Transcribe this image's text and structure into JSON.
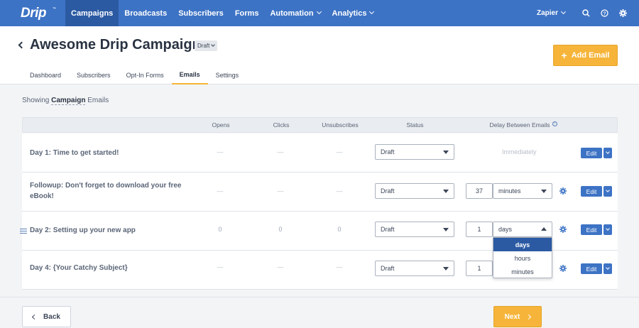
{
  "brand": {
    "logo": "Drip",
    "tm": "™",
    "primary": "#3d73c5",
    "accent": "#f6b53a"
  },
  "nav": {
    "items": [
      {
        "label": "Campaigns",
        "active": true
      },
      {
        "label": "Broadcasts"
      },
      {
        "label": "Subscribers"
      },
      {
        "label": "Forms"
      },
      {
        "label": "Automation"
      },
      {
        "label": "Analytics"
      }
    ],
    "user": "Zapier",
    "icons": [
      "search-icon",
      "help-icon",
      "gear-icon"
    ]
  },
  "header": {
    "title": "Awesome Drip Campaign",
    "status_badge": "Draft",
    "add_email": "Add Email",
    "add_email_icon": "+",
    "tabs": [
      "Dashboard",
      "Subscribers",
      "Opt-In Forms",
      "Emails",
      "Settings"
    ],
    "active_tab": "Emails"
  },
  "showing": {
    "prefix": "Showing",
    "filter": "Campaign",
    "suffix": "Emails"
  },
  "table": {
    "columns": {
      "opens": "Opens",
      "clicks": "Clicks",
      "unsubscribes": "Unsubscribes",
      "status": "Status",
      "delay": "Delay Between Emails"
    },
    "rows": [
      {
        "title": "Day 1: Time to get started!",
        "opens": "—",
        "clicks": "—",
        "unsubscribes": "—",
        "status": "Draft",
        "delay": "Immediately",
        "edit": "Edit"
      },
      {
        "title": "Followup: Don't forget to download your free eBook!",
        "opens": "—",
        "clicks": "—",
        "unsubscribes": "—",
        "status": "Draft",
        "delay_value": "37",
        "delay_unit": "minutes",
        "edit": "Edit"
      },
      {
        "title": "Day 2: Setting up your new app",
        "opens": "0",
        "clicks": "0",
        "unsubscribes": "0",
        "status": "Draft",
        "delay_value": "1",
        "delay_unit": "days",
        "edit": "Edit"
      },
      {
        "title": "Day 4: {Your Catchy Subject}",
        "opens": "—",
        "clicks": "—",
        "unsubscribes": "—",
        "status": "Draft",
        "delay_value": "1",
        "edit": "Edit"
      }
    ]
  },
  "unit_dropdown": {
    "options": [
      "days",
      "hours",
      "minutes"
    ],
    "selected": "days"
  },
  "footer": {
    "back": "Back",
    "next": "Next"
  }
}
